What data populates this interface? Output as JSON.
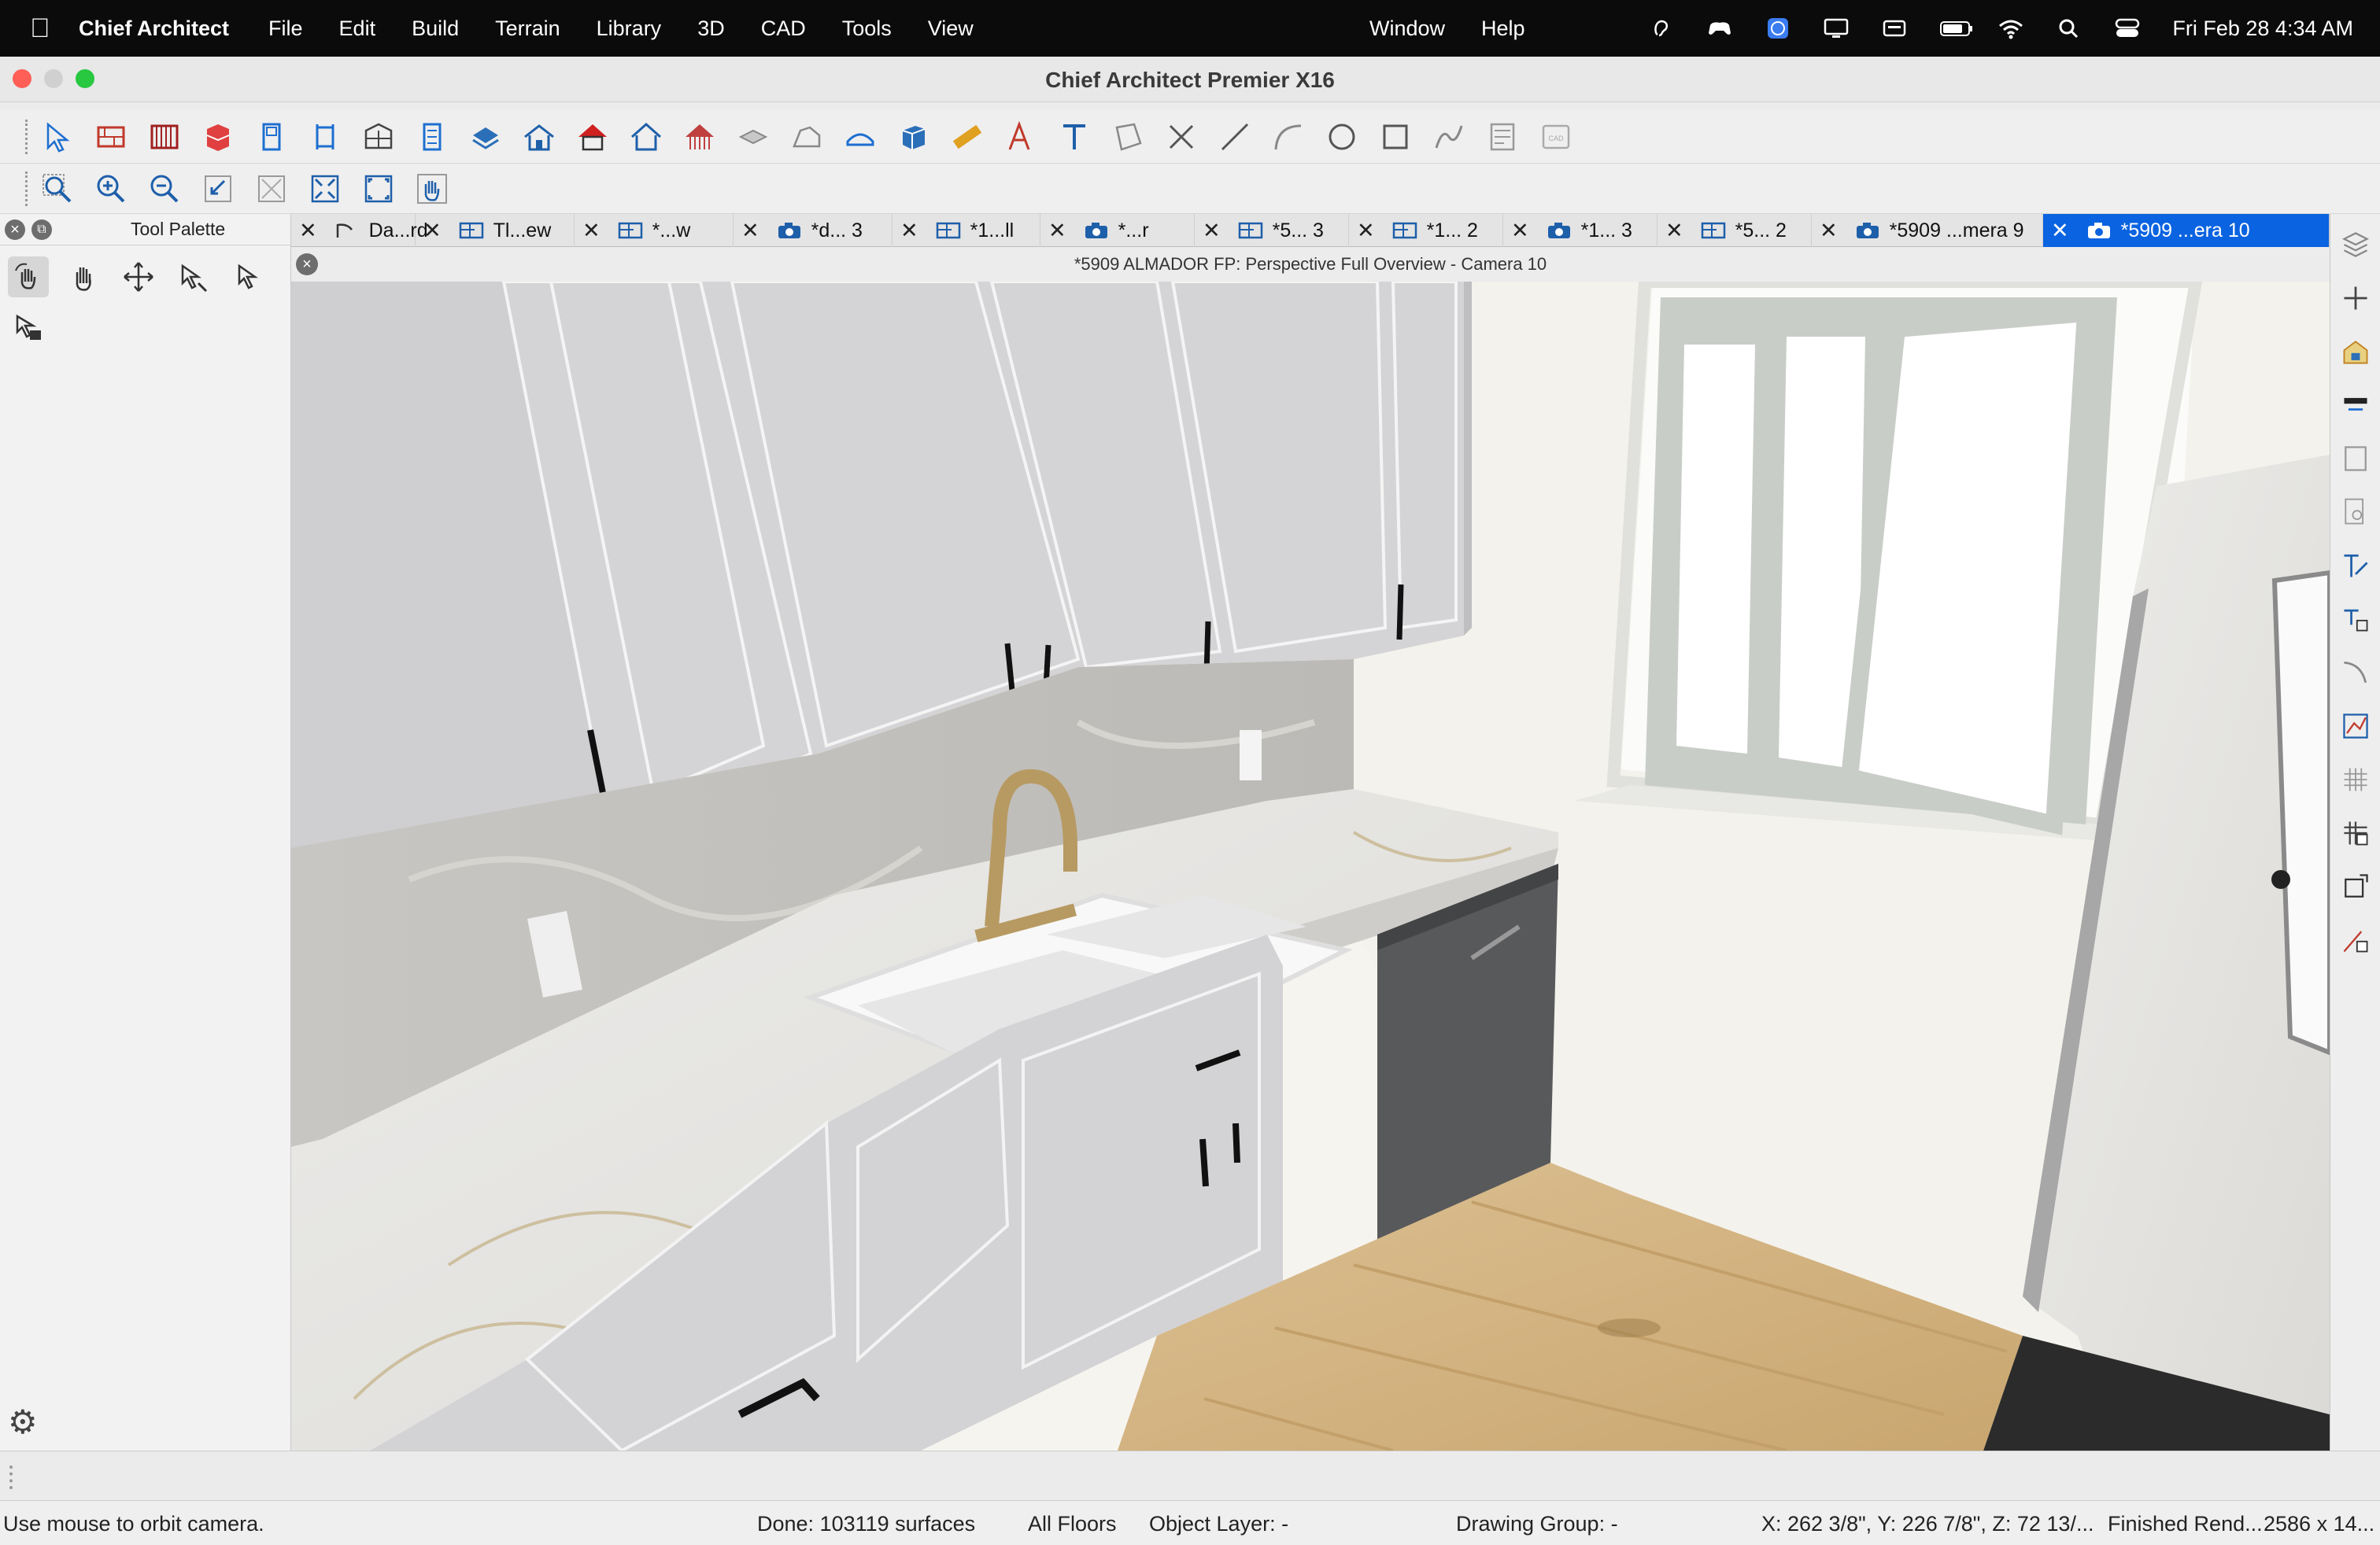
{
  "menubar": {
    "app_name": "Chief Architect",
    "menus": [
      "File",
      "Edit",
      "Build",
      "Terrain",
      "Library",
      "3D",
      "CAD",
      "Tools",
      "View"
    ],
    "right_menus": [
      "Window",
      "Help"
    ],
    "datetime": "Fri Feb 28  4:34 AM"
  },
  "window": {
    "title": "Chief Architect Premier X16"
  },
  "palette": {
    "title": "Tool Palette"
  },
  "tabs": [
    {
      "label": "Da...rd",
      "icon": "elevation-icon"
    },
    {
      "label": "Tl...ew",
      "icon": "plan-icon"
    },
    {
      "label": "*...w",
      "icon": "plan-icon"
    },
    {
      "label": "*d... 3",
      "icon": "camera-icon"
    },
    {
      "label": "*1...ll",
      "icon": "plan-icon"
    },
    {
      "label": "*...r",
      "icon": "camera-icon"
    },
    {
      "label": "*5... 3",
      "icon": "plan-icon"
    },
    {
      "label": "*1... 2",
      "icon": "plan-icon"
    },
    {
      "label": "*1... 3",
      "icon": "camera-icon"
    },
    {
      "label": "*5... 2",
      "icon": "plan-icon"
    },
    {
      "label": "*5909 ...mera 9",
      "icon": "camera-icon"
    },
    {
      "label": "*5909 ...era 10",
      "icon": "camera-icon",
      "active": true
    }
  ],
  "view": {
    "title": "*5909 ALMADOR FP: Perspective Full Overview - Camera 10"
  },
  "status": {
    "hint": "Use mouse to orbit camera.",
    "done": "Done:  103119 surfaces",
    "floors": "All Floors",
    "layer": "Object Layer: -",
    "group": "Drawing Group: -",
    "coords": "X: 262 3/8\", Y: 226 7/8\", Z: 72 13/...",
    "render": "Finished Rend...",
    "size": "2586 x 14..."
  },
  "colors": {
    "menubar_bg": "#0b0b0b",
    "active_tab": "#0a63e0",
    "cabinet": "#d4d4d6",
    "floor": "#d2b588"
  }
}
